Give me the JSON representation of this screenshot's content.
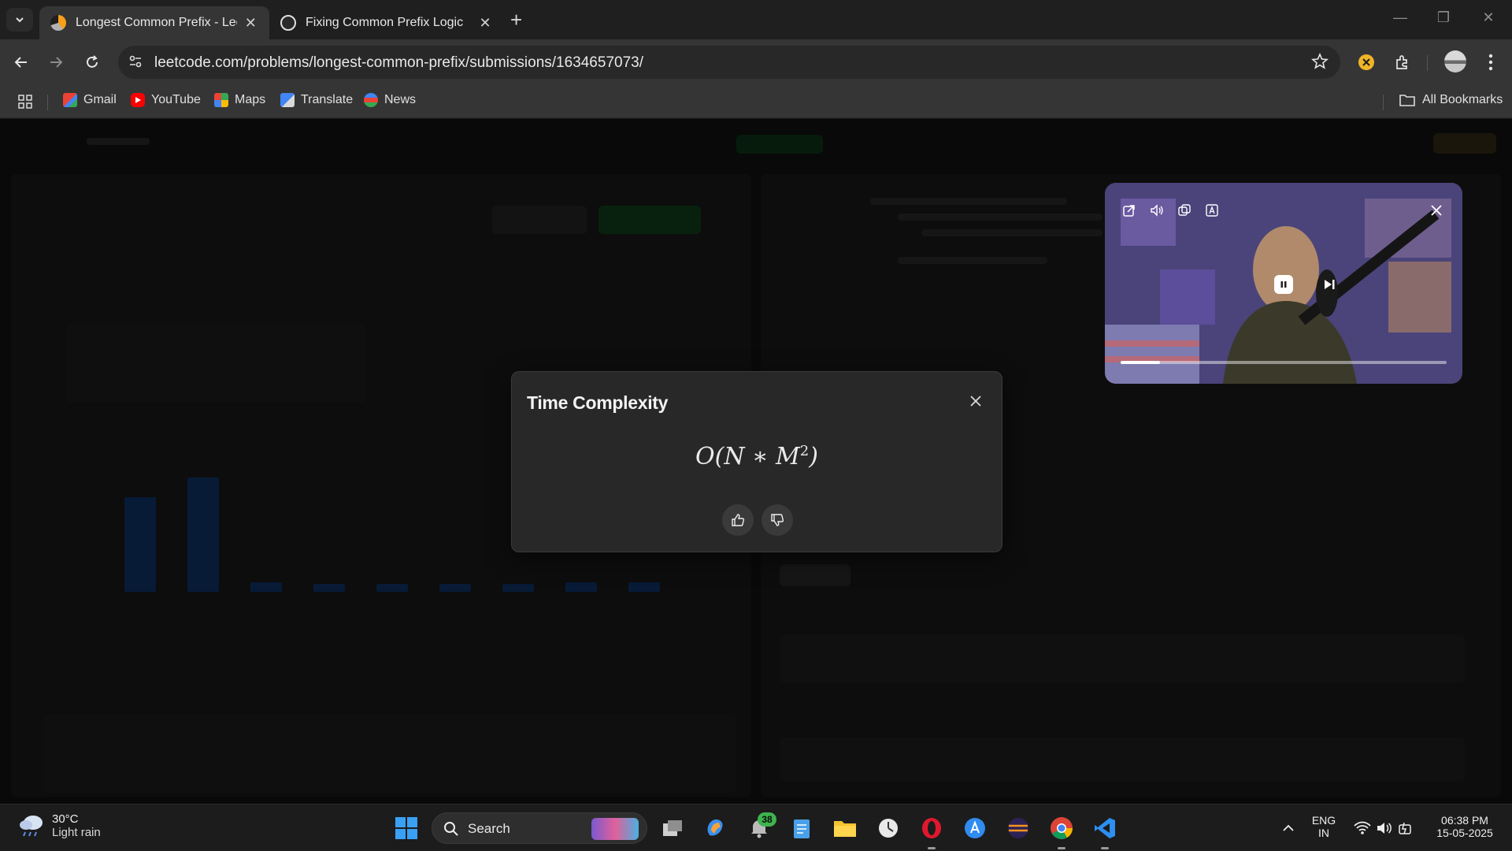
{
  "browser": {
    "tabs": [
      {
        "title": "Longest Common Prefix - LeetC",
        "active": true
      },
      {
        "title": "Fixing Common Prefix Logic",
        "active": false
      }
    ],
    "url": "leetcode.com/problems/longest-common-prefix/submissions/1634657073/",
    "bookmarks": [
      "Gmail",
      "YouTube",
      "Maps",
      "Translate",
      "News"
    ],
    "all_bookmarks_label": "All Bookmarks"
  },
  "modal": {
    "title": "Time Complexity",
    "formula_main": "O(N ∗ M",
    "formula_exp": "2",
    "formula_close": ")"
  },
  "pip": {
    "progress_fraction": 0.12
  },
  "taskbar": {
    "weather_temp": "30°C",
    "weather_desc": "Light rain",
    "search_label": "Search",
    "notification_count": "38",
    "lang_top": "ENG",
    "lang_bottom": "IN",
    "time": "06:38 PM",
    "date": "15-05-2025"
  },
  "colors": {
    "accent_green": "#3fb34f",
    "opera_red": "#e0182d",
    "vscode_blue": "#2d8ff0"
  }
}
